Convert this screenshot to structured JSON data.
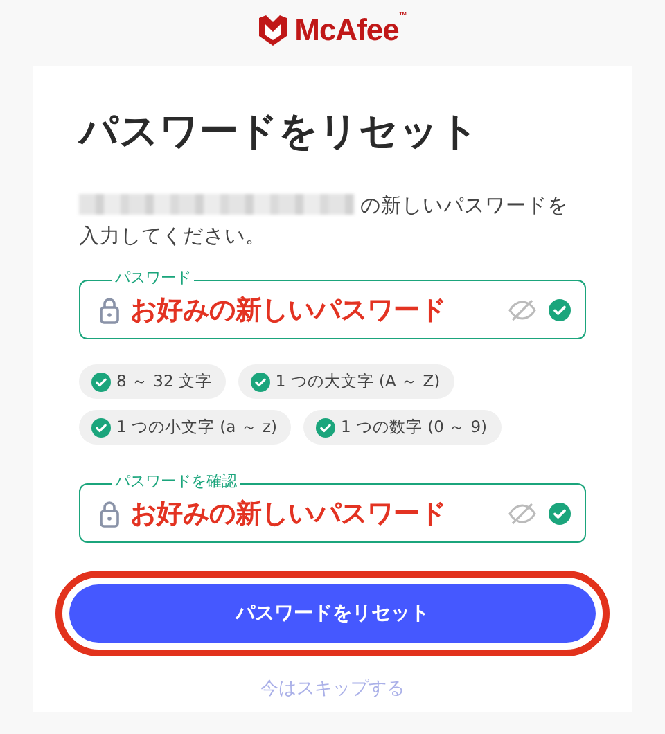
{
  "logo": {
    "text": "McAfee",
    "mark": "™"
  },
  "title": "パスワードをリセット",
  "instruction": "の新しいパスワードを入力してください。",
  "fields": [
    {
      "label": "パスワード",
      "value": "お好みの新しいパスワード",
      "valid": true
    },
    {
      "label": "パスワードを確認",
      "value": "お好みの新しいパスワード",
      "valid": true
    }
  ],
  "requirements": [
    {
      "text": "8 ～ 32 文字",
      "met": true
    },
    {
      "text": "1 つの大文字 (A ～ Z)",
      "met": true
    },
    {
      "text": "1 つの小文字 (a ～ z)",
      "met": true
    },
    {
      "text": "1 つの数字 (0 ～ 9)",
      "met": true
    }
  ],
  "primary_button": {
    "label": "パスワードをリセット",
    "highlighted": true
  },
  "skip_link": "今はスキップする"
}
